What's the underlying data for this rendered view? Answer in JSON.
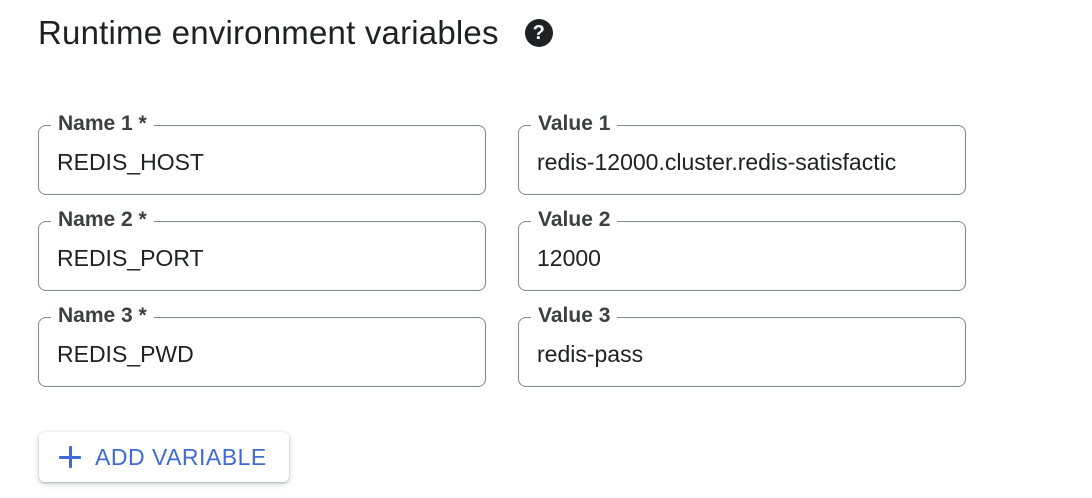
{
  "section": {
    "title": "Runtime environment variables",
    "help_icon": "question-circle-icon",
    "help_symbol": "?"
  },
  "variables": [
    {
      "name_label": "Name 1 *",
      "name_value": "REDIS_HOST",
      "value_label": "Value 1",
      "value_value": "redis-12000.cluster.redis-satisfactic"
    },
    {
      "name_label": "Name 2 *",
      "name_value": "REDIS_PORT",
      "value_label": "Value 2",
      "value_value": "12000"
    },
    {
      "name_label": "Name 3 *",
      "name_value": "REDIS_PWD",
      "value_label": "Value 3",
      "value_value": "redis-pass"
    }
  ],
  "add_button": {
    "icon": "plus-icon",
    "label": "ADD VARIABLE"
  },
  "colors": {
    "accent": "#3f6ad8",
    "border": "#80868b",
    "text": "#202124"
  }
}
